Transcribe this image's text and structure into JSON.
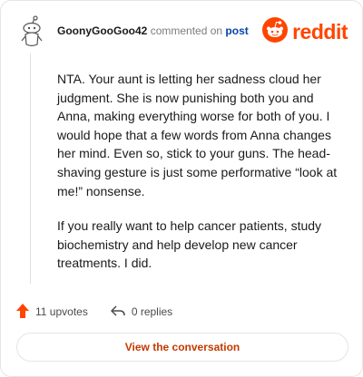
{
  "comment": {
    "username": "GoonyGooGoo42",
    "action_text": "commented on",
    "post_link": "post",
    "paragraphs": [
      "NTA. Your aunt is letting her sadness cloud her judgment. She is now punishing both you and Anna, making everything worse for both of you. I would hope that a few words from Anna changes her mind. Even so, stick to your guns. The head-shaving gesture is just some performative “look at me!” nonsense.",
      "If you really want to help cancer patients, study biochemistry and help develop new cancer treatments. I did."
    ]
  },
  "brand": {
    "name": "reddit",
    "color": "#ff4500"
  },
  "actions": {
    "upvotes": "11 upvotes",
    "replies": "0 replies"
  },
  "cta": {
    "label": "View the conversation"
  },
  "icons": {
    "avatar": "snoo-avatar-icon",
    "logo": "reddit-logo-icon",
    "upvote": "upvote-arrow-icon",
    "reply": "reply-arrow-icon"
  }
}
